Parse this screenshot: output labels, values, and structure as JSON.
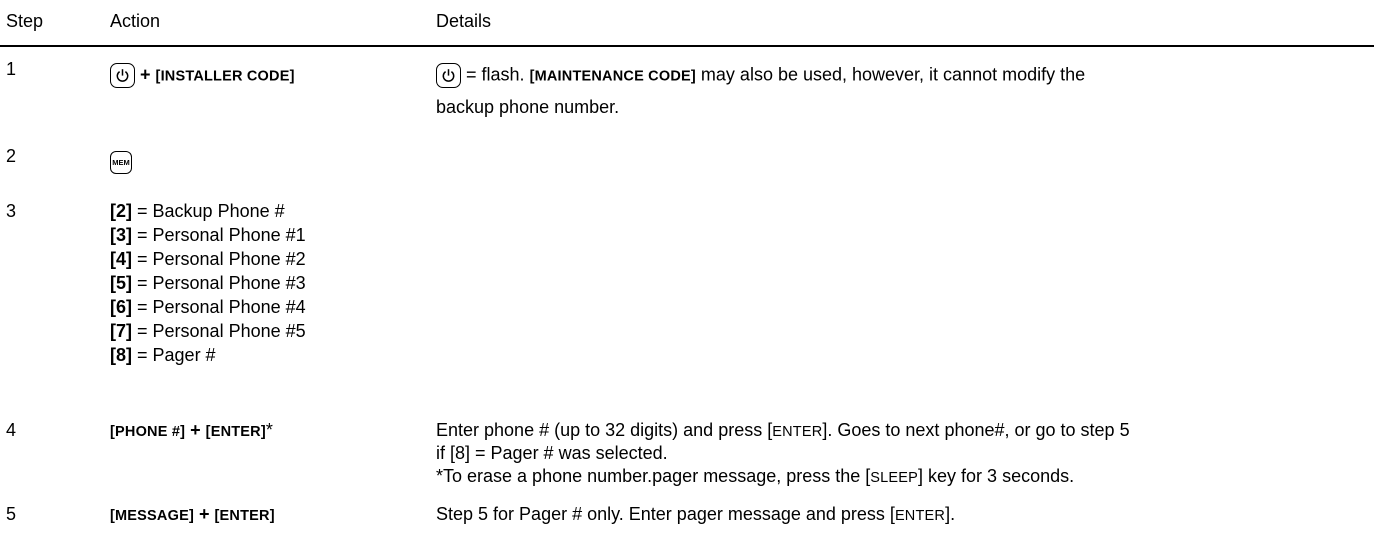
{
  "header": {
    "step": "Step",
    "action": "Action",
    "details": "Details"
  },
  "rows": [
    {
      "step": "1",
      "action_plus": "+",
      "action_code": "[INSTALLER CODE]",
      "details_text1": "= flash.",
      "details_code": "[MAINTENANCE CODE]",
      "details_text2": "may also be used, however, it cannot modify the",
      "details_line2": "backup phone number."
    },
    {
      "step": "2",
      "mem_label": "MEM"
    },
    {
      "step": "3",
      "items": [
        {
          "key": "[2]",
          "text": "= Backup Phone #"
        },
        {
          "key": "[3]",
          "text": "= Personal Phone #1"
        },
        {
          "key": "[4]",
          "text": "= Personal Phone #2"
        },
        {
          "key": "[5]",
          "text": "= Personal Phone #3"
        },
        {
          "key": "[6]",
          "text": "= Personal Phone #4"
        },
        {
          "key": "[7]",
          "text": "= Personal Phone #5"
        },
        {
          "key": "[8]",
          "text": "= Pager #"
        }
      ]
    },
    {
      "step": "4",
      "action_a": "[PHONE #]",
      "action_plus": "+",
      "action_b": "[ENTER]",
      "action_star": "*",
      "d1a": "Enter phone # (up to 32 digits) and press [",
      "d1key": "ENTER",
      "d1b": "]. Goes to next phone#, or go to step 5",
      "d2": "if [8] = Pager # was selected.",
      "d3a": "*To erase a phone number.pager message, press the [",
      "d3key": "SLEEP",
      "d3b": "] key for 3 seconds."
    },
    {
      "step": "5",
      "action_a": "[MESSAGE]",
      "action_plus": "+",
      "action_b": "[ENTER]",
      "d1a": "Step 5 for Pager # only. Enter pager message and press [",
      "d1key": "ENTER",
      "d1b": "]."
    }
  ],
  "icons": {
    "power": "power-key-icon",
    "mem": "mem-key-icon"
  }
}
